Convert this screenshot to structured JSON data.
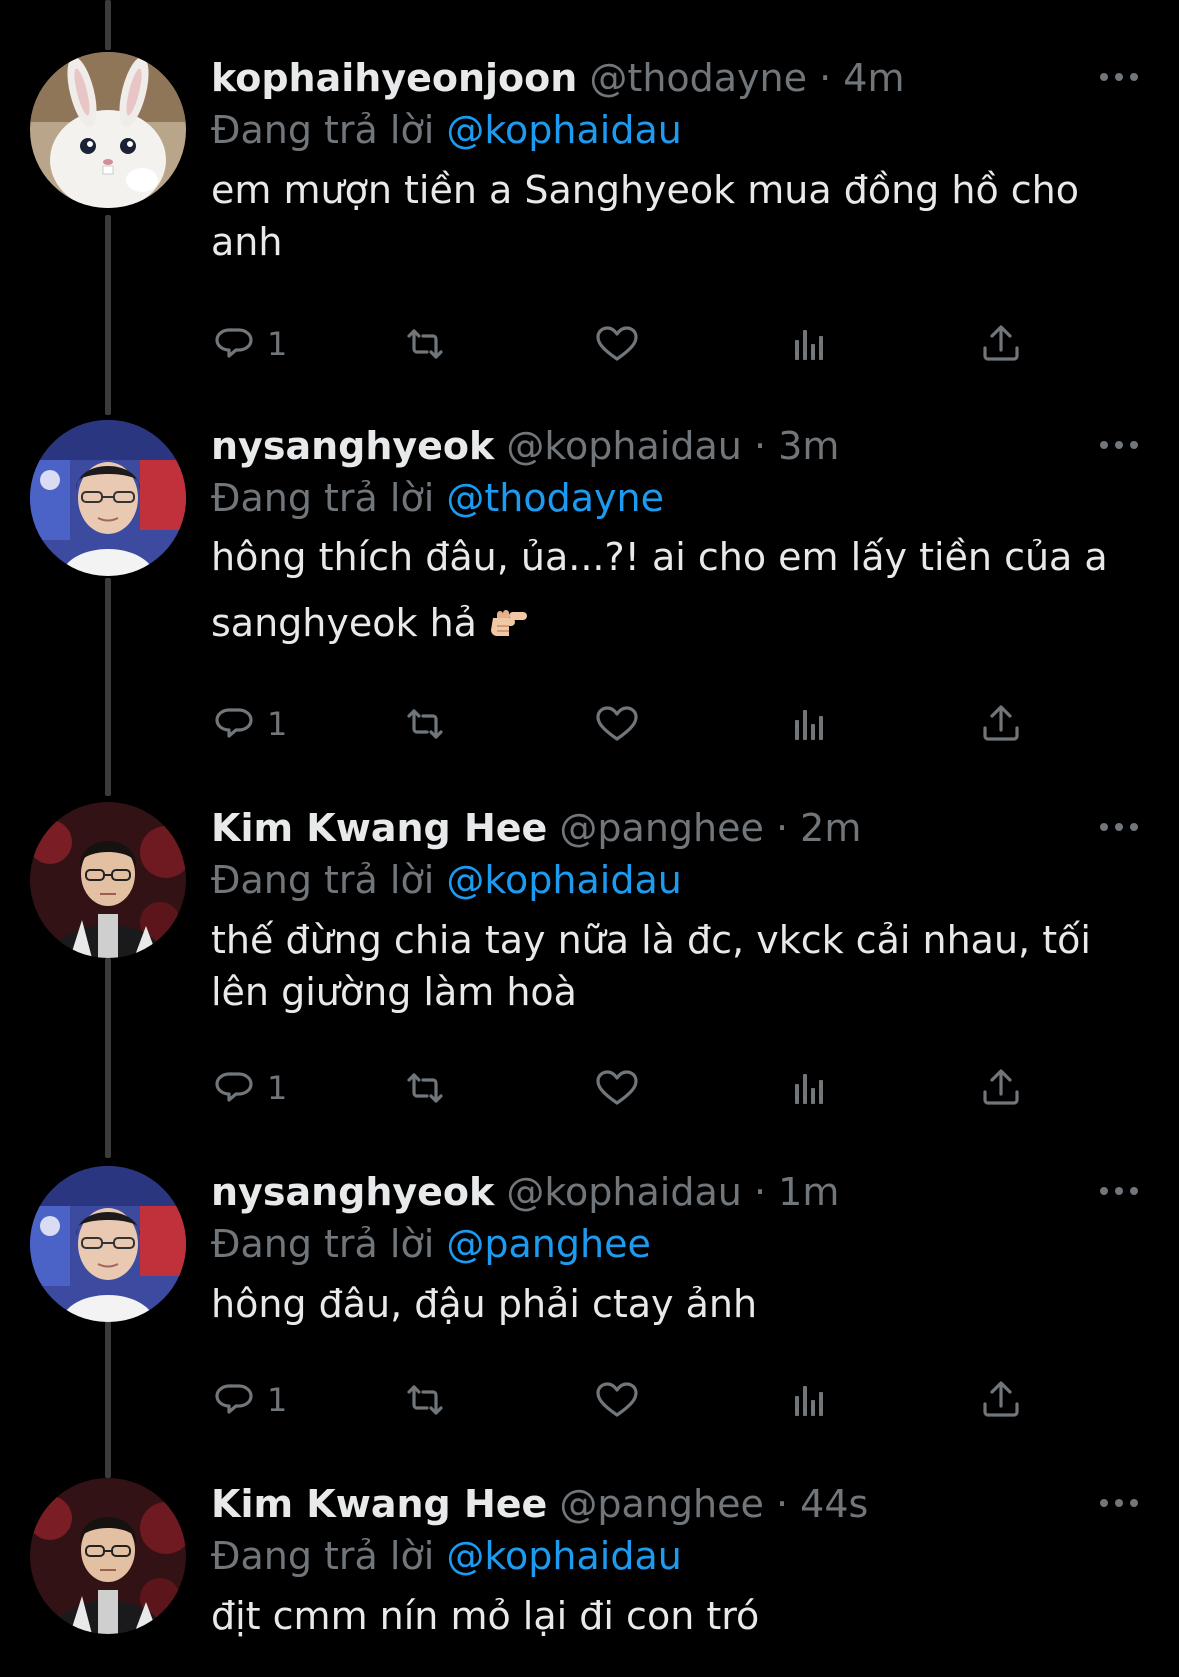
{
  "reply_prefix": "Đang trả lời",
  "tweets": [
    {
      "name": "kophaihyeonjoon",
      "handle": "@thodayne",
      "time": "4m",
      "reply_to": "@kophaidau",
      "text": "em mượn tiền a Sanghyeok mua đồng hồ cho\nanh",
      "reply_count": "1",
      "avatar": "bunny-avatar"
    },
    {
      "name": "nysanghyeok",
      "handle": "@kophaidau",
      "time": "3m",
      "reply_to": "@thodayne",
      "text": "hông thích đâu, ủa...?! ai cho em lấy tiền của a\nsanghyeok hả",
      "reply_count": "1",
      "avatar": "sanghyeok-avatar"
    },
    {
      "name": "Kim Kwang Hee",
      "handle": "@panghee",
      "time": "2m",
      "reply_to": "@kophaidau",
      "text": "thế đừng chia tay nữa là đc, vkck cải nhau, tối\nlên giường làm hoà",
      "reply_count": "1",
      "avatar": "panghee-avatar"
    },
    {
      "name": "nysanghyeok",
      "handle": "@kophaidau",
      "time": "1m",
      "reply_to": "@panghee",
      "text": "hông đâu, đậu phải ctay ảnh",
      "reply_count": "1",
      "avatar": "sanghyeok-avatar"
    },
    {
      "name": "Kim Kwang Hee",
      "handle": "@panghee",
      "time": "44s",
      "reply_to": "@kophaidau",
      "text": "địt cmm nín mỏ lại đi con tró",
      "reply_count": "",
      "avatar": "panghee-avatar"
    }
  ],
  "icons": {
    "reply": "reply-icon",
    "retweet": "retweet-icon",
    "like": "like-icon",
    "views": "views-icon",
    "share": "share-icon",
    "more": "more-icon",
    "emoji": "pointing-fist-emoji"
  },
  "colors": {
    "background": "#000000",
    "text": "#e7e9ea",
    "muted": "#71767b",
    "mention": "#1d9bf0",
    "thread_line": "#3a3b3c"
  }
}
